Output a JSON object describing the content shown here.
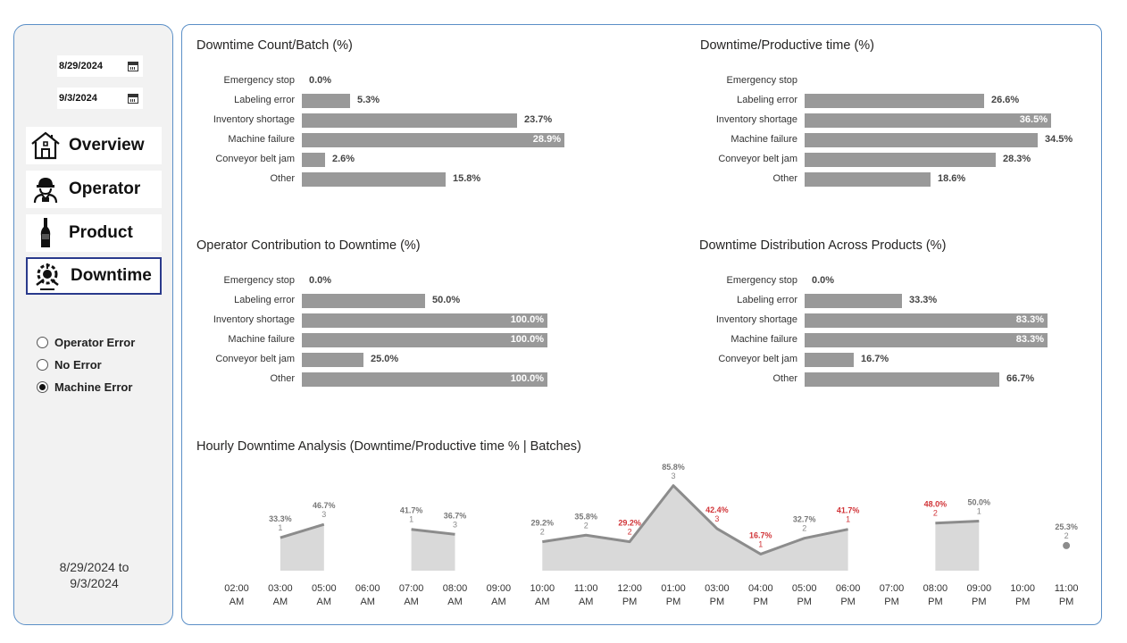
{
  "sidebar": {
    "start_date": "8/29/2024",
    "end_date": "9/3/2024",
    "nav": [
      {
        "label": "Overview",
        "icon": "house-icon",
        "active": false
      },
      {
        "label": "Operator",
        "icon": "worker-icon",
        "active": false
      },
      {
        "label": "Product",
        "icon": "bottle-icon",
        "active": false
      },
      {
        "label": "Downtime",
        "icon": "downtime-gear-icon",
        "active": true
      }
    ],
    "filters": [
      {
        "label": "Operator Error",
        "checked": false
      },
      {
        "label": "No Error",
        "checked": false
      },
      {
        "label": "Machine Error",
        "checked": true
      }
    ],
    "range_line1": "8/29/2024 to",
    "range_line2": "9/3/2024"
  },
  "colors": {
    "bar": "#999999",
    "area": "#d9d9d9",
    "line": "#8c8c8c",
    "highlight": "#d13438",
    "border": "#5b8fc7",
    "active_nav": "#2a3a8c"
  },
  "chart_data": [
    {
      "type": "bar",
      "title": "Downtime Count/Batch (%)",
      "categories": [
        "Emergency stop",
        "Labeling error",
        "Inventory shortage",
        "Machine failure",
        "Conveyor belt jam",
        "Other"
      ],
      "values": [
        0.0,
        5.3,
        23.7,
        28.9,
        2.6,
        15.8
      ],
      "labels": [
        "0.0%",
        "5.3%",
        "23.7%",
        "28.9%",
        "2.6%",
        "15.8%"
      ],
      "xlim": [
        0,
        28.9
      ]
    },
    {
      "type": "bar",
      "title": "Downtime/Productive time (%)",
      "categories": [
        "Emergency stop",
        "Labeling error",
        "Inventory shortage",
        "Machine failure",
        "Conveyor belt jam",
        "Other"
      ],
      "values": [
        null,
        26.6,
        36.5,
        34.5,
        28.3,
        18.6
      ],
      "labels": [
        "",
        "26.6%",
        "36.5%",
        "34.5%",
        "28.3%",
        "18.6%"
      ],
      "xlim": [
        0,
        36.5
      ]
    },
    {
      "type": "bar",
      "title": "Operator Contribution to Downtime (%)",
      "categories": [
        "Emergency stop",
        "Labeling error",
        "Inventory shortage",
        "Machine failure",
        "Conveyor belt jam",
        "Other"
      ],
      "values": [
        0.0,
        50.0,
        100.0,
        100.0,
        25.0,
        100.0
      ],
      "labels": [
        "0.0%",
        "50.0%",
        "100.0%",
        "100.0%",
        "25.0%",
        "100.0%"
      ],
      "xlim": [
        0,
        100
      ]
    },
    {
      "type": "bar",
      "title": "Downtime Distribution Across Products (%)",
      "categories": [
        "Emergency stop",
        "Labeling error",
        "Inventory shortage",
        "Machine failure",
        "Conveyor belt jam",
        "Other"
      ],
      "values": [
        0.0,
        33.3,
        83.3,
        83.3,
        16.7,
        66.7
      ],
      "labels": [
        "0.0%",
        "33.3%",
        "83.3%",
        "83.3%",
        "16.7%",
        "66.7%"
      ],
      "xlim": [
        0,
        83.3
      ]
    },
    {
      "type": "area",
      "title": "Hourly Downtime Analysis (Downtime/Productive time % | Batches)",
      "categories": [
        "02:00 AM",
        "03:00 AM",
        "05:00 AM",
        "06:00 AM",
        "07:00 AM",
        "08:00 AM",
        "09:00 AM",
        "10:00 AM",
        "11:00 AM",
        "12:00 PM",
        "01:00 PM",
        "03:00 PM",
        "04:00 PM",
        "05:00 PM",
        "06:00 PM",
        "07:00 PM",
        "08:00 PM",
        "09:00 PM",
        "10:00 PM",
        "11:00 PM"
      ],
      "values": [
        null,
        33.3,
        46.7,
        null,
        41.7,
        36.7,
        null,
        29.2,
        35.8,
        29.2,
        85.8,
        42.4,
        16.7,
        32.7,
        41.7,
        null,
        48.0,
        50.0,
        null,
        25.3
      ],
      "value_labels": [
        "",
        "33.3%",
        "46.7%",
        "",
        "41.7%",
        "36.7%",
        "",
        "29.2%",
        "35.8%",
        "29.2%",
        "85.8%",
        "42.4%",
        "16.7%",
        "32.7%",
        "41.7%",
        "",
        "48.0%",
        "50.0%",
        "",
        "25.3%"
      ],
      "batches": [
        "",
        "1",
        "3",
        "",
        "1",
        "3",
        "",
        "2",
        "2",
        "2",
        "3",
        "3",
        "1",
        "2",
        "1",
        "",
        "2",
        "1",
        "",
        "2"
      ],
      "highlighted": [
        false,
        false,
        false,
        false,
        false,
        false,
        false,
        false,
        false,
        true,
        false,
        true,
        true,
        false,
        true,
        false,
        true,
        false,
        false,
        false
      ],
      "ylim": [
        0,
        100
      ]
    }
  ]
}
